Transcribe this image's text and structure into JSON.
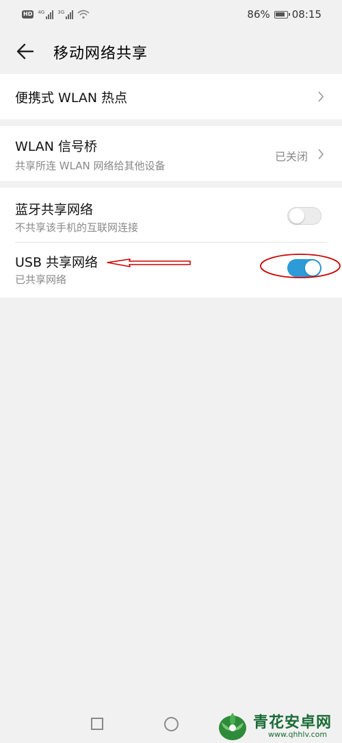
{
  "status_bar": {
    "left_icons": [
      "hd-icon",
      "signal-4g-icon",
      "signal-3g-icon",
      "wifi-icon"
    ],
    "net1": "4G",
    "net2": "3G",
    "battery_percent": "86%",
    "battery_level": 0.86,
    "time": "08:15"
  },
  "app_bar": {
    "title": "移动网络共享",
    "back_icon": "arrow-left-icon"
  },
  "rows": {
    "hotspot": {
      "title": "便携式 WLAN 热点"
    },
    "wlan_bridge": {
      "title": "WLAN 信号桥",
      "subtitle": "共享所连 WLAN 网络给其他设备",
      "status": "已关闭"
    },
    "bluetooth": {
      "title": "蓝牙共享网络",
      "subtitle": "不共享该手机的互联网连接",
      "enabled": false
    },
    "usb": {
      "title": "USB 共享网络",
      "subtitle": "已共享网络",
      "enabled": true
    }
  },
  "annotation": {
    "color": "#cc0000",
    "arrow_points_to": "usb-title",
    "circle_around": "usb-toggle"
  },
  "colors": {
    "toggle_on": "#2c9bd8",
    "background": "#f1f1f1"
  },
  "watermark": {
    "text": "青花安卓网",
    "url": "www.qhhlv.com"
  }
}
